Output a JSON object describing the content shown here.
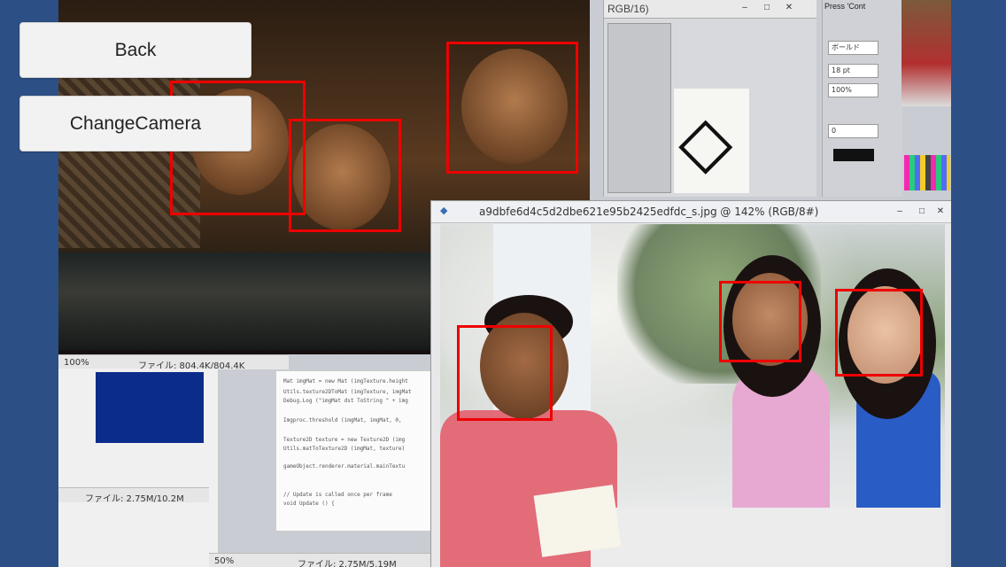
{
  "buttons": {
    "back": "Back",
    "change_camera": "ChangeCamera"
  },
  "camera_view": {
    "top_left_status": {
      "zoom": "100%",
      "file": "ファイル: 804.4K/804.4K"
    },
    "left_lower_status": {
      "file": "ファイル: 2.75M/10.2M"
    },
    "bottom_status": {
      "zoom": "50%",
      "file": "ファイル: 2.75M/5.19M"
    },
    "palette_title": "RGB/16)",
    "props_panel": {
      "header": "Press 'Cont",
      "font_weight": "ボールド",
      "font_size": "18 pt",
      "scale": "100%",
      "zero_field": "0"
    },
    "code_lines": [
      "Mat imgMat = new Mat (imgTexture.height",
      "Utils.texture2DToMat (imgTexture, imgMat",
      "Debug.Log (\"imgMat dst ToString \" + img",
      "Imgproc.threshold (imgMat, imgMat, 0,",
      "Texture2D texture = new Texture2D (img",
      "Utils.matToTexture2D (imgMat, texture)",
      "gameObject.renderer.material.mainTextu",
      "// Update is called once per frame",
      "void Update () {"
    ],
    "photoshop_window_title": "a9dbfe6d4c5d2dbe621e95b2425edfdc_s.jpg @ 142% (RGB/8#)"
  },
  "detections": {
    "face_count": 6,
    "box_color": "#e00000"
  },
  "colors": {
    "background": "#2c4f86",
    "button_bg": "#f2f2f2"
  }
}
